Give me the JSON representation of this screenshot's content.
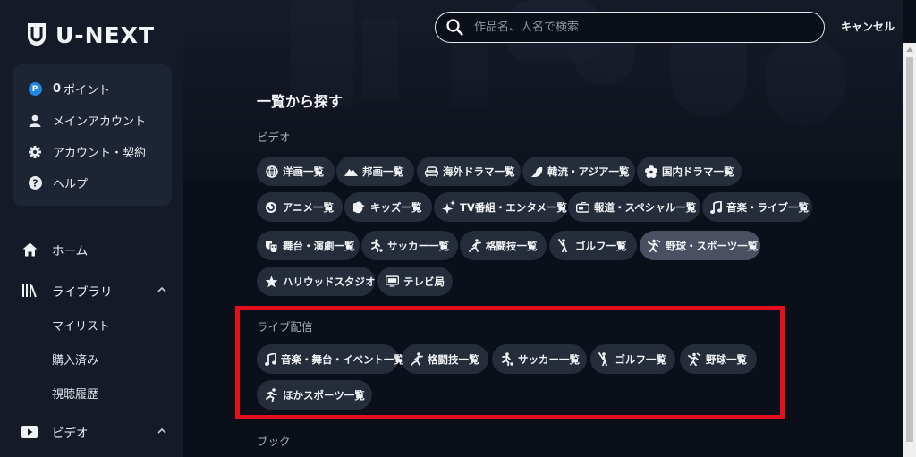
{
  "brand": {
    "name": "U-NEXT"
  },
  "account": {
    "points_value": "0",
    "points_label": "ポイント",
    "main_account": "メインアカウント",
    "contract": "アカウント・契約",
    "help": "ヘルプ",
    "point_badge": "P"
  },
  "nav": {
    "home": "ホーム",
    "library": "ライブラリ",
    "mylist": "マイリスト",
    "purchased": "購入済み",
    "history": "視聴履歴",
    "video": "ビデオ"
  },
  "search": {
    "placeholder": "作品名、人名で検索",
    "value": "",
    "cancel": "キャンセル"
  },
  "page": {
    "title": "一覧から探す",
    "video_section": "ビデオ",
    "live_section": "ライブ配信",
    "book_section": "ブック"
  },
  "video_chips": [
    {
      "label": "洋画一覧",
      "icon": "globe-icon"
    },
    {
      "label": "邦画一覧",
      "icon": "mountain-icon"
    },
    {
      "label": "海外ドラマ一覧",
      "icon": "sofa-icon"
    },
    {
      "label": "韓流・アジア一覧",
      "icon": "fan-icon"
    },
    {
      "label": "国内ドラマ一覧",
      "icon": "flower-icon"
    },
    {
      "label": "アニメ一覧",
      "icon": "swirl-icon"
    },
    {
      "label": "キッズ一覧",
      "icon": "chick-icon"
    },
    {
      "label": "TV番組・エンタメ一覧",
      "icon": "sparkle-icon"
    },
    {
      "label": "報道・スペシャル一覧",
      "icon": "camera-icon"
    },
    {
      "label": "音楽・ライブ一覧",
      "icon": "music-note-icon"
    },
    {
      "label": "舞台・演劇一覧",
      "icon": "theater-mask-icon"
    },
    {
      "label": "サッカー一覧",
      "icon": "soccer-player-icon"
    },
    {
      "label": "格闘技一覧",
      "icon": "fighter-icon"
    },
    {
      "label": "ゴルフ一覧",
      "icon": "golfer-icon"
    },
    {
      "label": "野球・スポーツ一覧",
      "icon": "baseball-player-icon"
    },
    {
      "label": "ハリウッドスタジオ",
      "icon": "star-icon"
    },
    {
      "label": "テレビ局",
      "icon": "tv-icon"
    }
  ],
  "live_chips": [
    {
      "label": "音楽・舞台・イベント一覧",
      "icon": "music-note-icon"
    },
    {
      "label": "格闘技一覧",
      "icon": "fighter-icon"
    },
    {
      "label": "サッカー一覧",
      "icon": "soccer-player-icon"
    },
    {
      "label": "ゴルフ一覧",
      "icon": "golfer-icon"
    },
    {
      "label": "野球一覧",
      "icon": "baseball-player-icon"
    },
    {
      "label": "ほかスポーツ一覧",
      "icon": "runner-icon"
    }
  ],
  "colors": {
    "background": "#0b0f19",
    "sidebar": "#141a27",
    "chip": "#252c3a",
    "chip_active": "#4a5061",
    "highlight": "#e4101e",
    "point_badge": "#1e88e5"
  }
}
